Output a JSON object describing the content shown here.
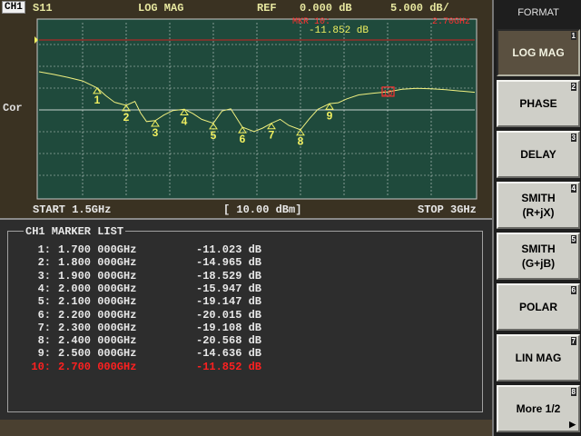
{
  "header": {
    "channel": "CH1",
    "parameter": "S11",
    "format": "LOG MAG",
    "ref_label": "REF",
    "ref_value": "0.000 dB",
    "scale": "5.000 dB/",
    "active_marker_label": "MKR 10:",
    "active_marker_freq": "2.70GHz",
    "active_marker_value": "-11.852 dB"
  },
  "plot": {
    "cor_label": "Cor",
    "start_label": "START 1.5GHz",
    "power_label": "[ 10.00 dBm]",
    "stop_label": "STOP 3GHz"
  },
  "marker_list": {
    "title": "CH1 MARKER LIST",
    "active_index": 9,
    "markers": [
      {
        "id": "1:",
        "freq": "1.700 000GHz",
        "value": "-11.023 dB"
      },
      {
        "id": "2:",
        "freq": "1.800 000GHz",
        "value": "-14.965 dB"
      },
      {
        "id": "3:",
        "freq": "1.900 000GHz",
        "value": "-18.529 dB"
      },
      {
        "id": "4:",
        "freq": "2.000 000GHz",
        "value": "-15.947 dB"
      },
      {
        "id": "5:",
        "freq": "2.100 000GHz",
        "value": "-19.147 dB"
      },
      {
        "id": "6:",
        "freq": "2.200 000GHz",
        "value": "-20.015 dB"
      },
      {
        "id": "7:",
        "freq": "2.300 000GHz",
        "value": "-19.108 dB"
      },
      {
        "id": "8:",
        "freq": "2.400 000GHz",
        "value": "-20.568 dB"
      },
      {
        "id": "9:",
        "freq": "2.500 000GHz",
        "value": "-14.636 dB"
      },
      {
        "id": "10:",
        "freq": "2.700 000GHz",
        "value": "-11.852 dB"
      }
    ]
  },
  "trace": {
    "start_ghz": 1.5,
    "stop_ghz": 3.0,
    "ref_db": 0,
    "db_per_div": 5,
    "divisions": 10,
    "points": [
      [
        1.5,
        -7.3
      ],
      [
        1.55,
        -7.9
      ],
      [
        1.6,
        -8.6
      ],
      [
        1.65,
        -9.4
      ],
      [
        1.7,
        -11.0
      ],
      [
        1.73,
        -12.8
      ],
      [
        1.76,
        -14.3
      ],
      [
        1.8,
        -15.0
      ],
      [
        1.83,
        -14.1
      ],
      [
        1.85,
        -16.8
      ],
      [
        1.87,
        -18.7
      ],
      [
        1.9,
        -18.5
      ],
      [
        1.93,
        -17.2
      ],
      [
        1.96,
        -16.2
      ],
      [
        2.0,
        -15.9
      ],
      [
        2.03,
        -16.9
      ],
      [
        2.06,
        -18.2
      ],
      [
        2.1,
        -19.1
      ],
      [
        2.13,
        -16.3
      ],
      [
        2.16,
        -15.8
      ],
      [
        2.2,
        -20.0
      ],
      [
        2.24,
        -21.0
      ],
      [
        2.27,
        -20.2
      ],
      [
        2.3,
        -19.1
      ],
      [
        2.33,
        -18.2
      ],
      [
        2.36,
        -19.6
      ],
      [
        2.4,
        -20.6
      ],
      [
        2.43,
        -18.1
      ],
      [
        2.46,
        -15.9
      ],
      [
        2.5,
        -14.6
      ],
      [
        2.53,
        -14.4
      ],
      [
        2.56,
        -13.5
      ],
      [
        2.6,
        -12.6
      ],
      [
        2.65,
        -12.2
      ],
      [
        2.7,
        -11.9
      ],
      [
        2.75,
        -11.3
      ],
      [
        2.8,
        -11.1
      ],
      [
        2.85,
        -11.2
      ],
      [
        2.9,
        -11.4
      ],
      [
        2.95,
        -11.7
      ],
      [
        3.0,
        -12.0
      ]
    ],
    "markers": [
      {
        "label": "1",
        "ghz": 1.7,
        "db": -11.023,
        "place": "below"
      },
      {
        "label": "2",
        "ghz": 1.8,
        "db": -14.965,
        "place": "below"
      },
      {
        "label": "3",
        "ghz": 1.9,
        "db": -18.529,
        "place": "below"
      },
      {
        "label": "4",
        "ghz": 2.0,
        "db": -15.947,
        "place": "below"
      },
      {
        "label": "5",
        "ghz": 2.1,
        "db": -19.147,
        "place": "below"
      },
      {
        "label": "6",
        "ghz": 2.2,
        "db": -20.015,
        "place": "below"
      },
      {
        "label": "7",
        "ghz": 2.3,
        "db": -19.108,
        "place": "below"
      },
      {
        "label": "8",
        "ghz": 2.4,
        "db": -20.568,
        "place": "below"
      },
      {
        "label": "9",
        "ghz": 2.5,
        "db": -14.636,
        "place": "below"
      },
      {
        "label": "10",
        "ghz": 2.7,
        "db": -11.852,
        "place": "box"
      }
    ],
    "colors": {
      "trace": "#f0f080",
      "marker": "#f0f060",
      "active_marker": "#ff3030",
      "grid": "#ffffff",
      "ref_line": "#d02020",
      "background": "#1f4a3c"
    }
  },
  "menu": {
    "title": "FORMAT",
    "items": [
      {
        "label": "LOG MAG",
        "label2": "",
        "num": "1",
        "selected": true
      },
      {
        "label": "PHASE",
        "label2": "",
        "num": "2",
        "selected": false
      },
      {
        "label": "DELAY",
        "label2": "",
        "num": "3",
        "selected": false
      },
      {
        "label": "SMITH",
        "label2": "(R+jX)",
        "num": "4",
        "selected": false
      },
      {
        "label": "SMITH",
        "label2": "(G+jB)",
        "num": "5",
        "selected": false
      },
      {
        "label": "POLAR",
        "label2": "",
        "num": "6",
        "selected": false
      },
      {
        "label": "LIN MAG",
        "label2": "",
        "num": "7",
        "selected": false
      },
      {
        "label": "More 1/2",
        "label2": "",
        "num": "8",
        "selected": false,
        "arrow": "▶"
      }
    ]
  }
}
